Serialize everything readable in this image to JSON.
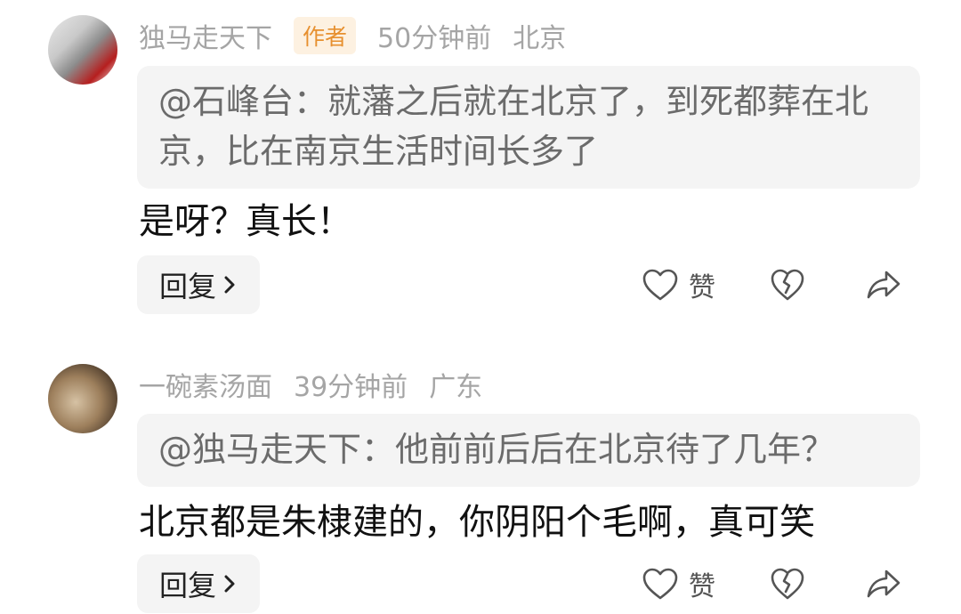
{
  "comments": [
    {
      "username": "独马走天下",
      "badge": "作者",
      "time": "50分钟前",
      "location": "北京",
      "quote": "@石峰台：就藩之后就在北京了，到死都葬在北京，比在南京生活时间长多了",
      "text": "是呀？真长！",
      "reply_label": "回复",
      "like_label": "赞"
    },
    {
      "username": "一碗素汤面",
      "time": "39分钟前",
      "location": "广东",
      "quote": "@独马走天下：他前前后后在北京待了几年？",
      "text": "北京都是朱棣建的，你阴阳个毛啊，真可笑",
      "reply_label": "回复",
      "like_label": "赞"
    }
  ],
  "icons": {
    "like": "heart-outline-icon",
    "dislike": "broken-heart-icon",
    "share": "share-arrow-icon",
    "reply_chevron": "chevron-right-icon"
  },
  "colors": {
    "meta": "#a5a5a5",
    "badge_text": "#e7902f",
    "badge_bg": "#fdf1e1",
    "quote_bg": "#f4f4f4",
    "quote_text": "#6b6b6b"
  }
}
